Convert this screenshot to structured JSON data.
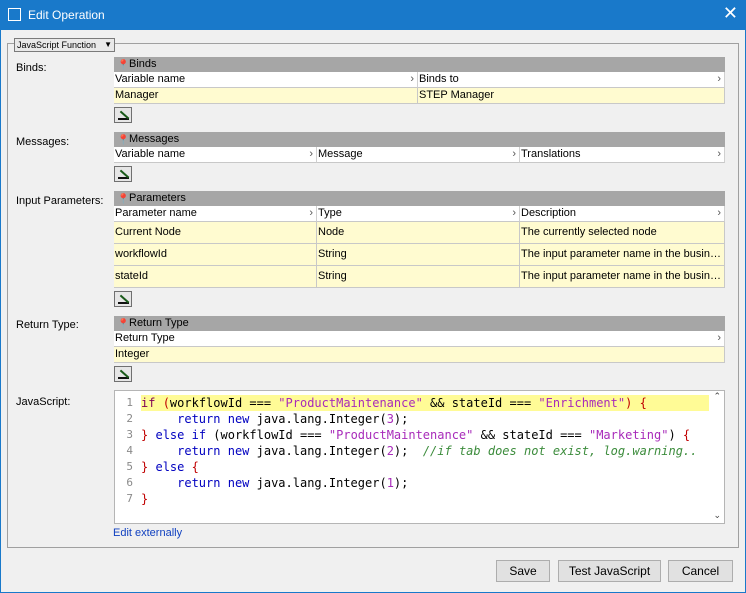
{
  "window": {
    "title": "Edit Operation"
  },
  "combo": {
    "value": "JavaScript Function"
  },
  "binds": {
    "label": "Binds:",
    "header": "Binds",
    "columns": [
      "Variable name",
      "Binds to"
    ],
    "rows": [
      [
        "Manager",
        "STEP Manager"
      ]
    ]
  },
  "messages": {
    "label": "Messages:",
    "header": "Messages",
    "columns": [
      "Variable name",
      "Message",
      "Translations"
    ]
  },
  "params": {
    "label": "Input Parameters:",
    "header": "Parameters",
    "columns": [
      "Parameter name",
      "Type",
      "Description"
    ],
    "rows": [
      [
        "Current Node",
        "Node",
        "The currently selected node"
      ],
      [
        "workflowId",
        "String",
        "The input parameter name in the business"
      ],
      [
        "stateId",
        "String",
        "The input parameter name in the business"
      ]
    ]
  },
  "return_type": {
    "label": "Return Type:",
    "header": "Return Type",
    "column": "Return Type",
    "value": "Integer"
  },
  "javascript": {
    "label": "JavaScript:",
    "line_numbers": [
      "1",
      "2",
      "3",
      "4",
      "5",
      "6",
      "7"
    ],
    "link": "Edit externally"
  },
  "buttons": {
    "save": "Save",
    "test": "Test JavaScript",
    "cancel": "Cancel"
  }
}
